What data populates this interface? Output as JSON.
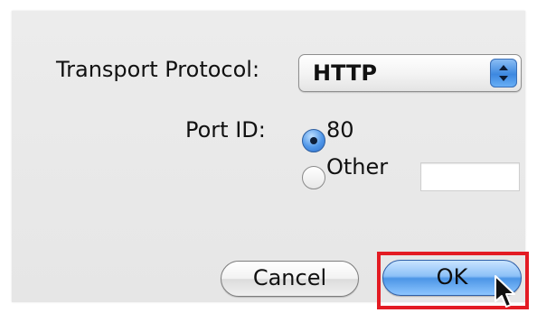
{
  "dialog": {
    "transport_label": "Transport Protocol:",
    "transport_value": "HTTP",
    "port_label": "Port ID:",
    "radio_80_label": "80",
    "radio_other_label": "Other",
    "other_value": "",
    "cancel_label": "Cancel",
    "ok_label": "OK",
    "selected_port": "80"
  },
  "colors": {
    "highlight": "#e31b23",
    "accent": "#4c95e6"
  },
  "icons": {
    "select_arrows": "up-down-arrows-icon",
    "cursor": "mouse-pointer-icon"
  }
}
